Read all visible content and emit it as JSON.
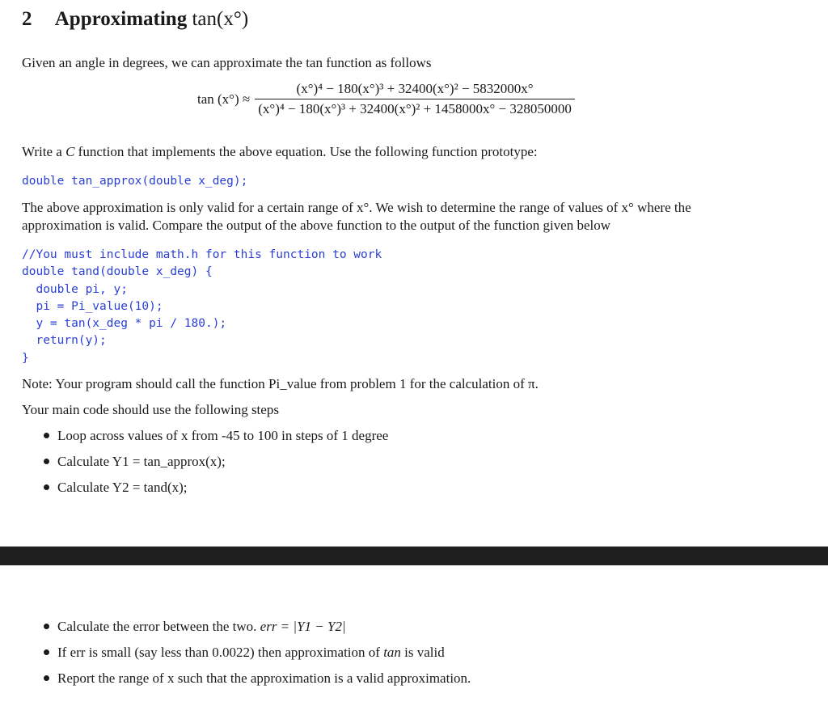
{
  "section": {
    "number": "2",
    "title": "Approximating",
    "title_math": "tan(x°)"
  },
  "intro": "Given an angle in degrees, we can approximate the tan function as follows",
  "equation": {
    "lhs": "tan (x°) ≈",
    "numerator": "(x°)⁴ − 180(x°)³ + 32400(x°)² − 5832000x°",
    "denominator": "(x°)⁴ − 180(x°)³ + 32400(x°)² + 1458000x° − 328050000"
  },
  "instruction": {
    "before": "Write a ",
    "lang": "C",
    "after": " function that implements the above equation. Use the following function prototype:"
  },
  "prototype": "double tan_approx(double x_deg);",
  "validity_text": {
    "line1": "The above approximation is only valid for a certain range of x°. We wish to determine the range of values of x° where the",
    "line2": "approximation is valid. Compare the output of the above function to the output of the function given below"
  },
  "code_lines": [
    "//You must include math.h for this function to work",
    "double tand(double x_deg) {",
    "  double pi, y;",
    "  pi = Pi_value(10);",
    "  y = tan(x_deg * pi / 180.);",
    "  return(y);",
    "}"
  ],
  "note": "Note: Your program should call the function Pi_value from problem 1 for the calculation of π.",
  "main_intro": "Your main code should use the following steps",
  "steps_part1": [
    "Loop across values of x from -45 to 100 in steps of 1 degree",
    "Calculate Y1 = tan_approx(x);",
    "Calculate Y2 = tand(x);"
  ],
  "steps_part2": [
    {
      "before": "Calculate the error between the two. ",
      "math": "err = |Y1 − Y2|",
      "after": ""
    },
    {
      "before": "If err is small (say less than 0.0022) then approximation of ",
      "math": "tan",
      "after": " is valid"
    },
    {
      "before": "Report the range of x such that the approximation is a valid approximation.",
      "math": "",
      "after": ""
    }
  ]
}
